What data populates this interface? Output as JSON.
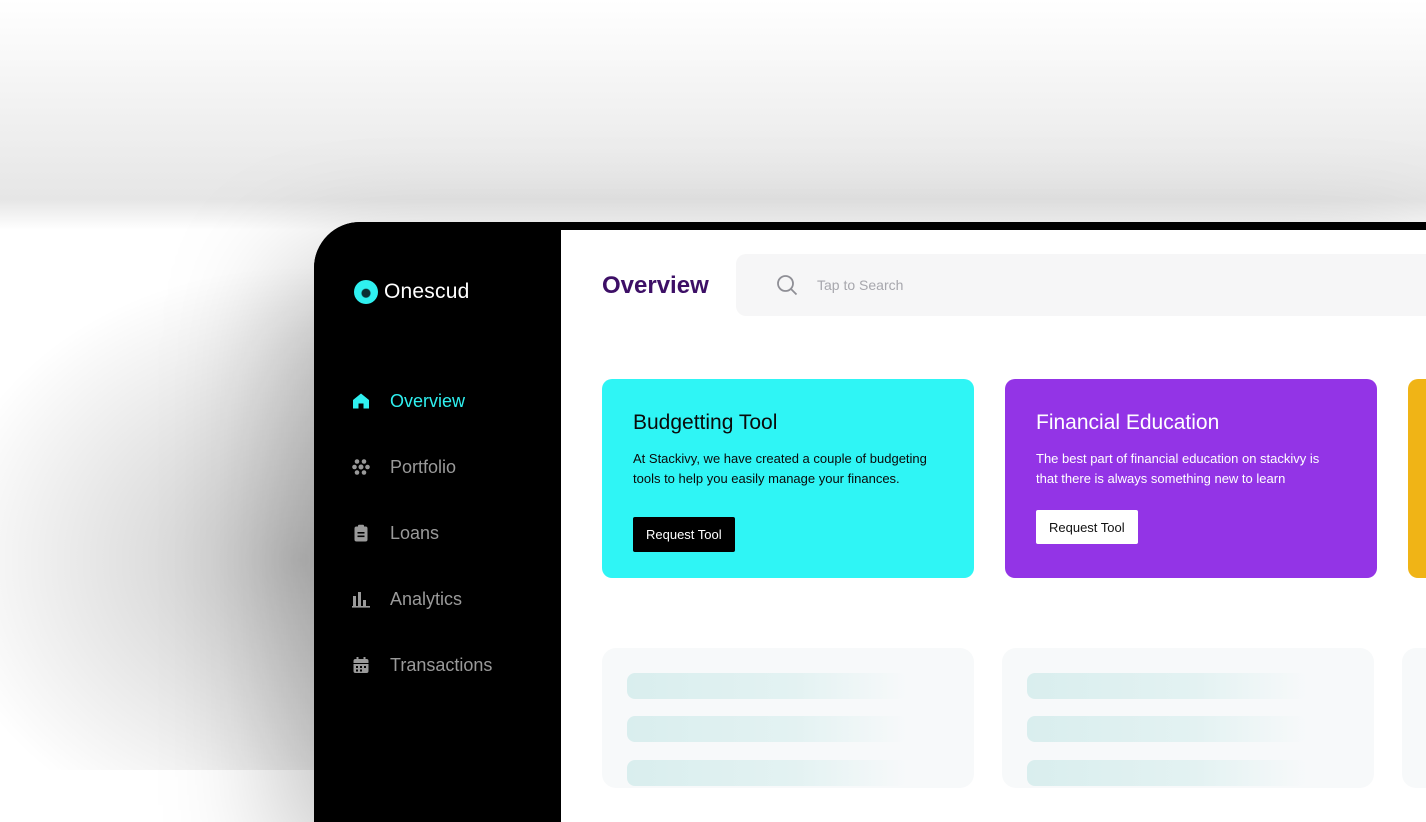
{
  "app": {
    "name": "Onescud"
  },
  "sidebar": {
    "items": [
      {
        "label": "Overview",
        "icon": "home-icon",
        "active": true
      },
      {
        "label": "Portfolio",
        "icon": "dots-cluster-icon",
        "active": false
      },
      {
        "label": "Loans",
        "icon": "clipboard-icon",
        "active": false
      },
      {
        "label": "Analytics",
        "icon": "bar-chart-icon",
        "active": false
      },
      {
        "label": "Transactions",
        "icon": "calendar-icon",
        "active": false
      }
    ]
  },
  "header": {
    "title": "Overview",
    "search": {
      "placeholder": "Tap to Search"
    }
  },
  "cards": [
    {
      "title": "Budgetting Tool",
      "description": "At Stackivy, we have created a couple of budgeting tools to help you easily manage your finances.",
      "button": "Request Tool",
      "color": "#2ff5f5"
    },
    {
      "title": "Financial Education",
      "description": "The best part of financial education on stackivy is that there is always something new to learn",
      "button": "Request Tool",
      "color": "#9334e6"
    }
  ],
  "colors": {
    "accent": "#2ff0f0",
    "title": "#3d0f66",
    "third_card": "#f0b416"
  }
}
